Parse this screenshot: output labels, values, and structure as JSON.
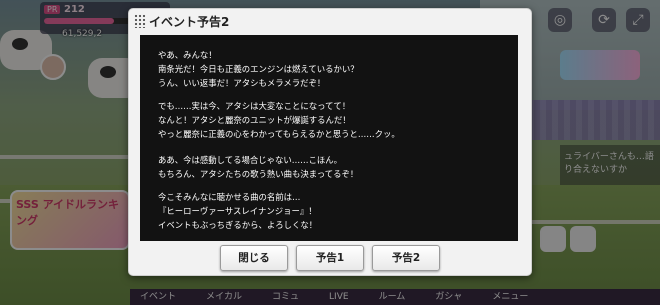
{
  "hud": {
    "pr_badge": "PR",
    "stamina": "212",
    "money": "61,529,2",
    "stamina_ratio": 0.7
  },
  "background": {
    "event_banner_text": "SSS アイドルランキング",
    "chat_text": "ュライバーさんも…語り合えないすか",
    "bottom_nav": [
      "イベント",
      "メイカル",
      "コミュ",
      "LIVE",
      "ルーム",
      "ガシャ",
      "メニュー"
    ]
  },
  "dialog": {
    "title": "イベント予告2",
    "paragraphs": [
      [
        "やあ、みんな！",
        "南条光だ！今日も正義のエンジンは燃えているかい？",
        "うん、いい返事だ！アタシもメラメラだぞ！"
      ],
      [
        "でも……実は今、アタシは大変なことになってて！",
        "なんと！アタシと麗奈のユニットが爆誕するんだ！",
        "やっと麗奈に正義の心をわかってもらえるかと思うと……クッ。"
      ],
      [
        "ああ、今は感動してる場合じゃない……こほん。",
        "もちろん、アタシたちの歌う熱い曲も決まってるぞ！"
      ],
      [
        "今こそみんなに聴かせる曲の名前は…",
        "『ヒーローヴァーサスレイナンジョー』！",
        "イベントもぶっちぎるから、よろしくな！"
      ]
    ],
    "buttons": {
      "close": "閉じる",
      "notice1": "予告1",
      "notice2": "予告2"
    }
  }
}
